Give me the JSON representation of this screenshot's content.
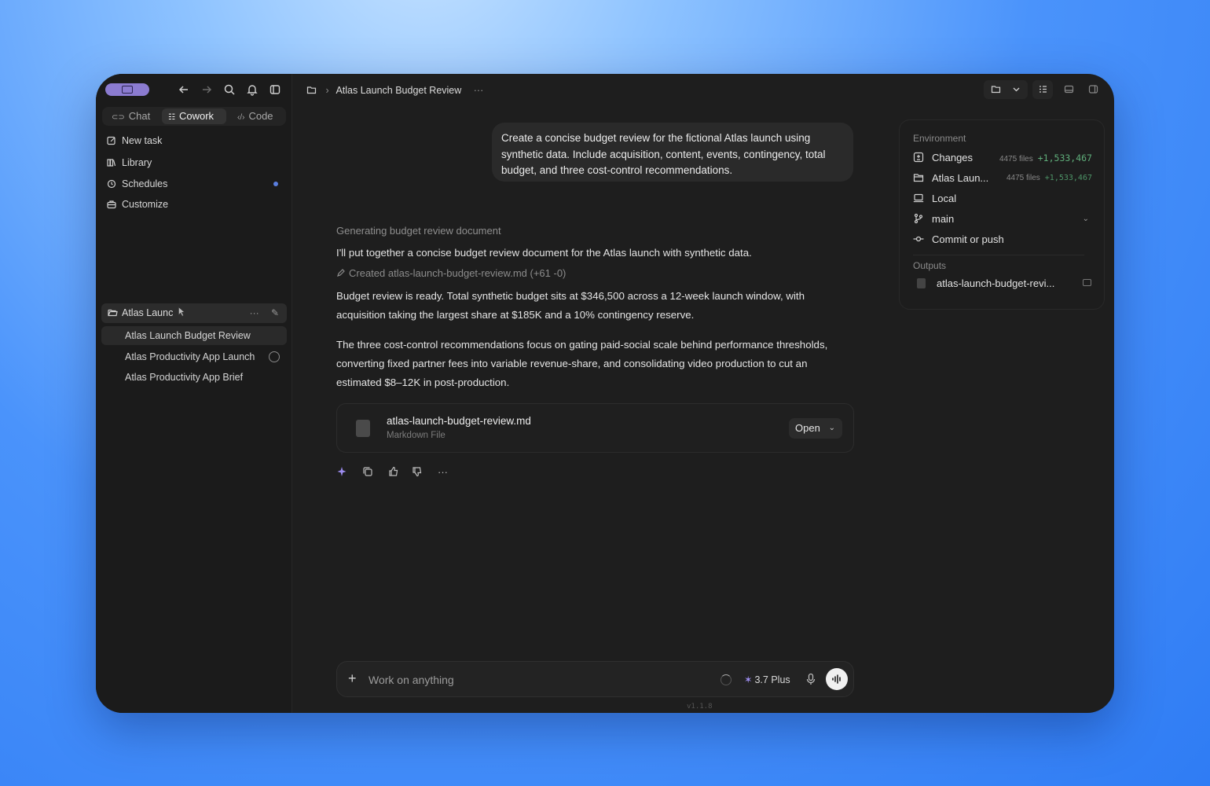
{
  "sidebar": {
    "modes": [
      {
        "label": "Chat",
        "glyph": "chat-icon"
      },
      {
        "label": "Cowork",
        "glyph": "cowork-icon"
      },
      {
        "label": "Code",
        "glyph": "code-icon"
      }
    ],
    "nav": [
      {
        "label": "New task",
        "icon": "edit-icon"
      },
      {
        "label": "Library",
        "icon": "library-icon"
      },
      {
        "label": "Schedules",
        "icon": "clock-icon"
      },
      {
        "label": "Customize",
        "icon": "briefcase-icon"
      }
    ],
    "project": {
      "name": "Atlas Launc",
      "more": "···"
    },
    "threads": [
      {
        "label": "Atlas Launch Budget Review"
      },
      {
        "label": "Atlas Productivity App Launch"
      },
      {
        "label": "Atlas Productivity App Brief"
      }
    ]
  },
  "header": {
    "title": "Atlas Launch Budget Review",
    "more": "···"
  },
  "conversation": {
    "user_message": "Create a concise budget review for the fictional Atlas launch using synthetic data. Include acquisition, content, events, contingency, total budget, and three cost-control recommendations.",
    "status": "Generating budget review document",
    "intro": "I'll put together a concise budget review document for the Atlas launch with synthetic data.",
    "created": "Created atlas-launch-budget-review.md (+61 -0)",
    "para1": "Budget review is ready. Total synthetic budget sits at $346,500 across a 12-week launch window, with acquisition taking the largest share at $185K and a 10% contingency reserve.",
    "para2": "The three cost-control recommendations focus on gating paid-social scale behind performance thresholds, converting fixed partner fees into variable revenue-share, and consolidating video production to cut an estimated $8–12K in post-production.",
    "file": {
      "name": "atlas-launch-budget-review.md",
      "type": "Markdown File",
      "open_label": "Open"
    },
    "more": "···"
  },
  "composer": {
    "placeholder": "Work on anything",
    "model": "3.7 Plus",
    "version": "v1.1.8"
  },
  "environment": {
    "label": "Environment",
    "changes": {
      "label": "Changes",
      "files": "4475 files",
      "delta": "+1,533,467"
    },
    "project": {
      "label": "Atlas Laun...",
      "files": "4475 files",
      "delta": "+1,533,467"
    },
    "local": "Local",
    "branch": "main",
    "commit": "Commit or push",
    "outputs_label": "Outputs",
    "output_file": "atlas-launch-budget-revi..."
  },
  "colors": {
    "accent": "#8b7bd0",
    "positive": "#5fae7a",
    "badge": "#5b7fe0"
  }
}
